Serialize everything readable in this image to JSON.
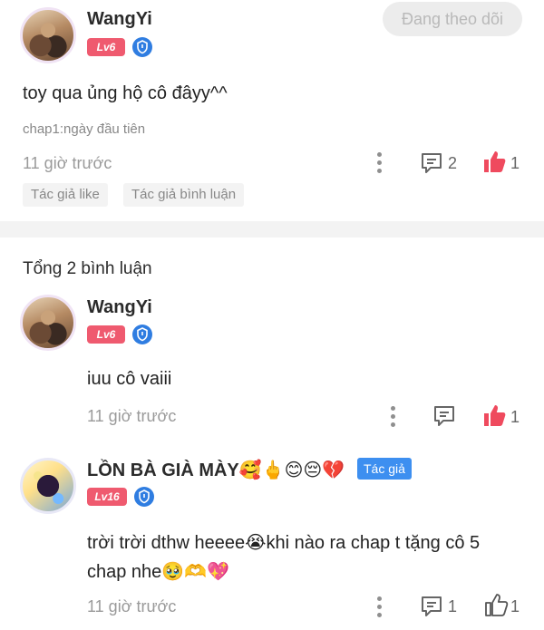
{
  "main_comment": {
    "username": "WangYi",
    "level": "Lv6",
    "follow_label": "Đang theo dõi",
    "text": "toy qua ủng hộ cô đâyy^^",
    "chapter": "chap1:ngày đầu tiên",
    "time": "11 giờ trước",
    "reply_count": "2",
    "like_count": "1",
    "tags": [
      "Tác giả like",
      "Tác giả bình luận"
    ]
  },
  "replies_header": "Tổng 2 bình luận",
  "replies": [
    {
      "username": "WangYi",
      "level": "Lv6",
      "text": "iuu cô vaiii",
      "time": "11 giờ trước",
      "like_count": "1"
    },
    {
      "username": "LỒN BÀ GIÀ MÀY",
      "username_emoji": "🥰🖕😊😔💔",
      "author_tag": "Tác giả",
      "level": "Lv16",
      "text_line1": "trời trời dthw heeee😭khi nào ra chap t tặng cô 5",
      "text_line2": "chap nhe🥹🫶💖",
      "time": "11 giờ trước",
      "reply_count": "1",
      "like_count": "1"
    }
  ],
  "colors": {
    "like_active": "#ef4a5e",
    "level_badge": "#ef5a6f",
    "author_tag": "#3d8ff0",
    "shield": "#2f7de1"
  },
  "icons": [
    "avatar",
    "shield-icon",
    "more-dots-icon",
    "comment-icon",
    "thumbs-up-icon"
  ]
}
